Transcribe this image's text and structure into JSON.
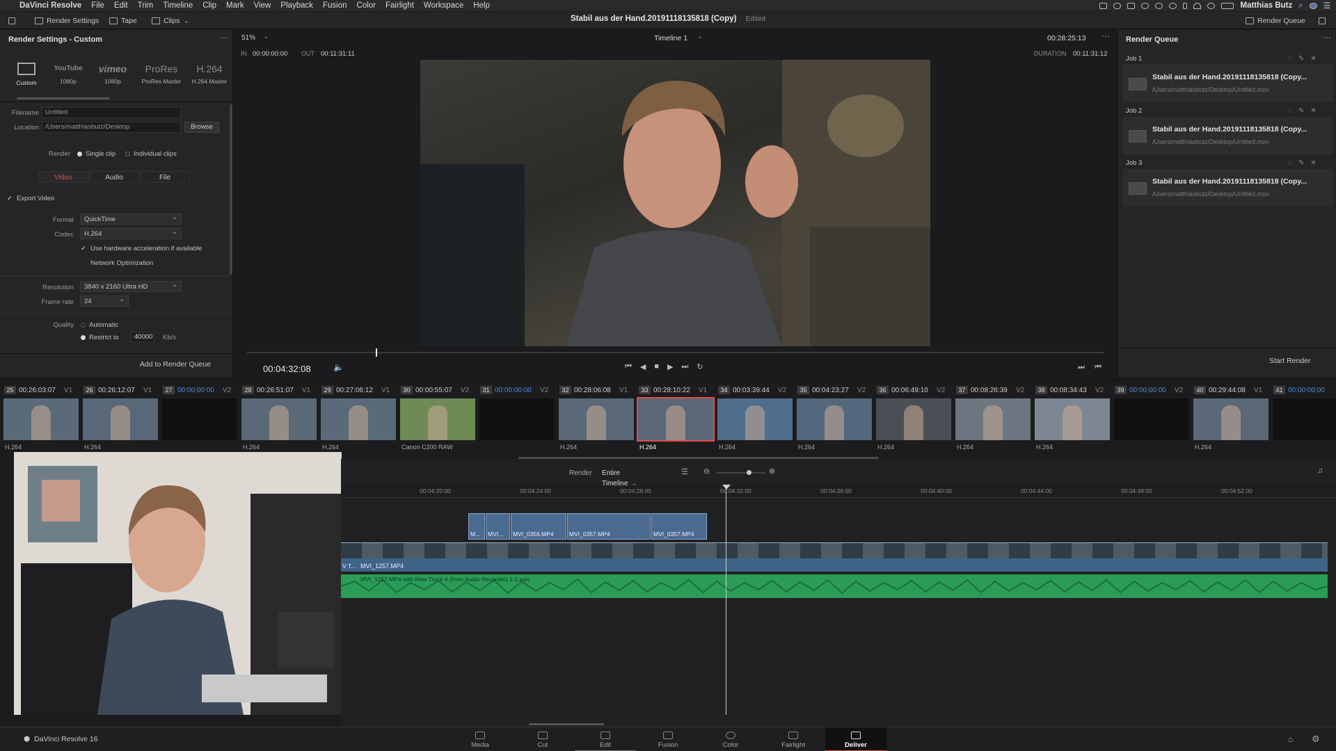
{
  "menubar": {
    "app": "DaVinci Resolve",
    "items": [
      "File",
      "Edit",
      "Trim",
      "Timeline",
      "Clip",
      "Mark",
      "View",
      "Playback",
      "Fusion",
      "Color",
      "Fairlight",
      "Workspace",
      "Help"
    ],
    "user": "Matthias Butz"
  },
  "toolbar": {
    "render_settings": "Render Settings",
    "tape": "Tape",
    "clips": "Clips",
    "project_title": "Stabil aus der Hand.20191118135818 (Copy)",
    "edited": "Edited",
    "render_queue": "Render Queue"
  },
  "render_settings": {
    "title": "Render Settings - Custom",
    "presets": [
      {
        "name": "",
        "label": "Custom"
      },
      {
        "name": "YouTube",
        "label": "1080p"
      },
      {
        "name": "vimeo",
        "label": "1080p"
      },
      {
        "name": "ProRes",
        "label": "ProRes Master"
      },
      {
        "name": "H.264",
        "label": "H.264 Master"
      }
    ],
    "filename_label": "Filename",
    "filename": "Untitled",
    "location_label": "Location",
    "location": "/Users/matthiasbutz/Desktop",
    "browse": "Browse",
    "render_label": "Render",
    "single_clip": "Single clip",
    "individual_clips": "Individual clips",
    "tabs": [
      "Video",
      "Audio",
      "File"
    ],
    "export_video": "Export Video",
    "format_label": "Format",
    "format": "QuickTime",
    "codec_label": "Codec",
    "codec": "H.264",
    "hw_accel": "Use hardware acceleration if available",
    "network_opt": "Network Optimization",
    "resolution_label": "Resolution",
    "resolution": "3840 x 2160 Ultra HD",
    "framerate_label": "Frame rate",
    "framerate": "24",
    "quality_label": "Quality",
    "automatic": "Automatic",
    "restrict_to": "Restrict to",
    "bitrate": "40000",
    "bitrate_unit": "Kb/s",
    "add_queue": "Add to Render Queue"
  },
  "viewer": {
    "zoom": "51%",
    "timeline": "Timeline 1",
    "timecode_top": "00:28:25:13",
    "in_label": "IN",
    "in": "00:00:00:00",
    "out_label": "OUT",
    "out": "00:11:31:11",
    "duration_label": "DURATION",
    "duration": "00:11:31:12",
    "current_tc": "00:04:32:08",
    "playhead": 0.15
  },
  "render_queue": {
    "title": "Render Queue",
    "jobs": [
      {
        "label": "Job 1",
        "title": "Stabil aus der Hand.20191118135818 (Copy...",
        "path": "/Users/matthiasbutz/Desktop/Untitled.mov"
      },
      {
        "label": "Job 2",
        "title": "Stabil aus der Hand.20191118135818 (Copy...",
        "path": "/Users/matthiasbutz/Desktop/Untitled.mov"
      },
      {
        "label": "Job 3",
        "title": "Stabil aus der Hand.20191118135818 (Copy...",
        "path": "/Users/matthiasbutz/Desktop/Untitled.mov"
      }
    ],
    "start_render": "Start Render"
  },
  "clips": [
    {
      "num": "25",
      "tc": "00:26:03:07",
      "track": "V1",
      "codec": "H.264",
      "tone": "#5b6a7a"
    },
    {
      "num": "26",
      "tc": "00:26:12:07",
      "track": "V1",
      "codec": "H.264",
      "tone": "#596878"
    },
    {
      "num": "27",
      "tc": "00:00:00:00",
      "track": "V2",
      "codec": "",
      "tone": "#111"
    },
    {
      "num": "28",
      "tc": "00:26:51:07",
      "track": "V1",
      "codec": "H.264",
      "tone": "#5a6878"
    },
    {
      "num": "29",
      "tc": "00:27:06:12",
      "track": "V1",
      "codec": "H.264",
      "tone": "#5a6a7a"
    },
    {
      "num": "30",
      "tc": "00:00:55:07",
      "track": "V2",
      "codec": "Canon C200 RAW",
      "tone": "#6f8a55"
    },
    {
      "num": "31",
      "tc": "00:00:00:00",
      "track": "V2",
      "codec": "",
      "tone": "#111"
    },
    {
      "num": "32",
      "tc": "00:28:06:08",
      "track": "V1",
      "codec": "H.264",
      "tone": "#5a6878"
    },
    {
      "num": "33",
      "tc": "00:28:10:22",
      "track": "V1",
      "codec": "H.264",
      "tone": "#5b6777"
    },
    {
      "num": "34",
      "tc": "00:03:39:44",
      "track": "V2",
      "codec": "H.264",
      "tone": "#4f6e8e"
    },
    {
      "num": "35",
      "tc": "00:04:23:27",
      "track": "V2",
      "codec": "H.264",
      "tone": "#53687c"
    },
    {
      "num": "36",
      "tc": "00:06:49:10",
      "track": "V2",
      "codec": "H.264",
      "tone": "#4a4f56"
    },
    {
      "num": "37",
      "tc": "00:08:26:39",
      "track": "V2",
      "codec": "H.264",
      "tone": "#6d7680"
    },
    {
      "num": "38",
      "tc": "00:08:34:43",
      "track": "V2",
      "codec": "H.264",
      "tone": "#7d8794"
    },
    {
      "num": "39",
      "tc": "00:00:00:00",
      "track": "V2",
      "codec": "",
      "tone": "#111"
    },
    {
      "num": "40",
      "tc": "00:29:44:08",
      "track": "V1",
      "codec": "H.264",
      "tone": "#5a6878"
    },
    {
      "num": "41",
      "tc": "00:00:00:00",
      "track": "",
      "codec": "",
      "tone": "#111"
    }
  ],
  "timeline": {
    "render_label": "Render",
    "render_mode": "Entire Timeline",
    "ruler": [
      "00:04:20:00",
      "00:04:24:00",
      "00:04:28:00",
      "00:04:32:00",
      "00:04:36:00",
      "00:04:40:00",
      "00:04:44:00",
      "00:04:48:00",
      "00:04:52:00"
    ],
    "v2_clips": [
      "M...",
      "MVI...",
      "MVI_0356.MP4",
      "MVI_0357.MP4",
      "MVI_0357.MP4"
    ],
    "v1_clip": "MVI_1257.MP4",
    "a1_clip": "MVI_1257.MP4 with New Track 4 (from Audio Recorder) 1-1.wav",
    "v1_prefix": "V T..."
  },
  "pages": [
    "Media",
    "Cut",
    "Edit",
    "Fusion",
    "Color",
    "Fairlight",
    "Deliver"
  ],
  "bottom": {
    "product": "DaVinci Resolve 16"
  },
  "colors": {
    "accent": "#e64b4b",
    "clip_blue": "#4a6a90",
    "audio_green": "#2ea65a"
  }
}
